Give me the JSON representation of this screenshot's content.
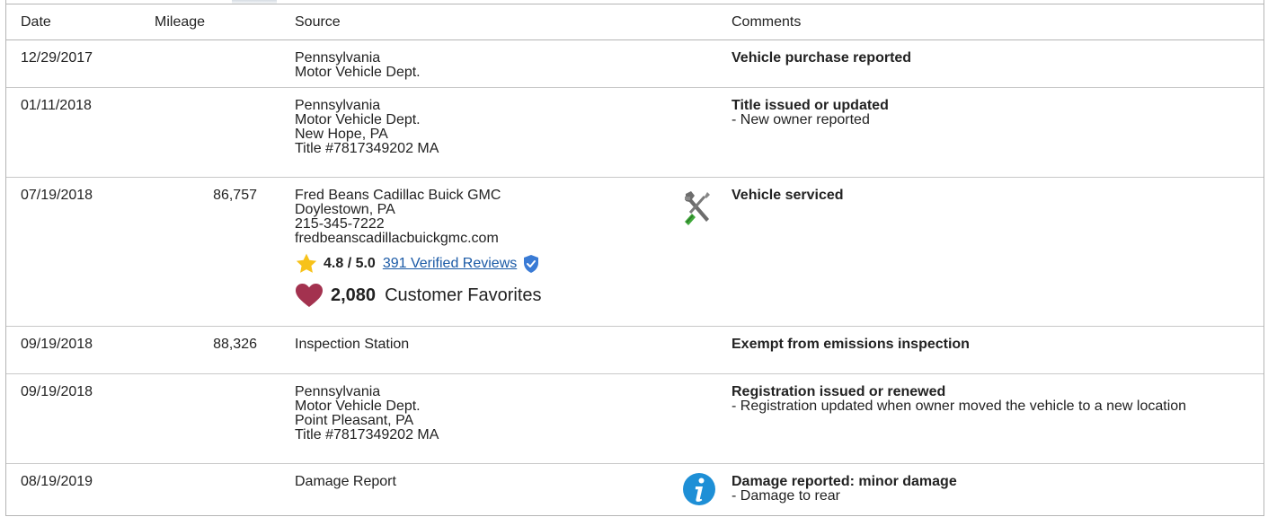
{
  "headers": {
    "date": "Date",
    "mileage": "Mileage",
    "source": "Source",
    "comments": "Comments"
  },
  "records": [
    {
      "date": "12/29/2017",
      "mileage": "",
      "source": [
        "Pennsylvania",
        "Motor Vehicle Dept."
      ],
      "comment_title": "Vehicle purchase reported",
      "comment_details": []
    },
    {
      "date": "01/11/2018",
      "mileage": "",
      "source": [
        "Pennsylvania",
        "Motor Vehicle Dept.",
        "New Hope, PA",
        "Title #7817349202 MA"
      ],
      "comment_title": "Title issued or updated",
      "comment_details": [
        "- New owner reported"
      ]
    },
    {
      "date": "07/19/2018",
      "mileage": "86,757",
      "source": [
        "Fred Beans Cadillac Buick GMC",
        "Doylestown, PA",
        "215-345-7222",
        "fredbeanscadillacbuickgmc.com"
      ],
      "rating": {
        "score": "4.8 / 5.0",
        "reviews_link": "391 Verified Reviews",
        "stars": 4.8
      },
      "favorites": {
        "count": "2,080",
        "label": "Customer Favorites"
      },
      "icon": "wrench-screwdriver-icon",
      "comment_title": "Vehicle serviced",
      "comment_details": []
    },
    {
      "date": "09/19/2018",
      "mileage": "88,326",
      "source": [
        "Inspection Station"
      ],
      "comment_title": "Exempt from emissions inspection",
      "comment_details": []
    },
    {
      "date": "09/19/2018",
      "mileage": "",
      "source": [
        "Pennsylvania",
        "Motor Vehicle Dept.",
        "Point Pleasant, PA",
        "Title #7817349202 MA"
      ],
      "comment_title": "Registration issued or renewed",
      "comment_details": [
        "- Registration updated when owner moved the vehicle to a new location"
      ]
    },
    {
      "date": "08/19/2019",
      "mileage": "",
      "source": [
        "Damage Report"
      ],
      "icon": "info-icon",
      "comment_title": "Damage reported: minor damage",
      "comment_details": [
        "- Damage to rear"
      ]
    }
  ],
  "colors": {
    "link": "#1b5aa6",
    "star": "#f7c21a",
    "heart": "#a3324f",
    "verified_badge": "#3a7bd5",
    "info_icon": "#1e8fd6",
    "border": "#b5b5b5"
  }
}
